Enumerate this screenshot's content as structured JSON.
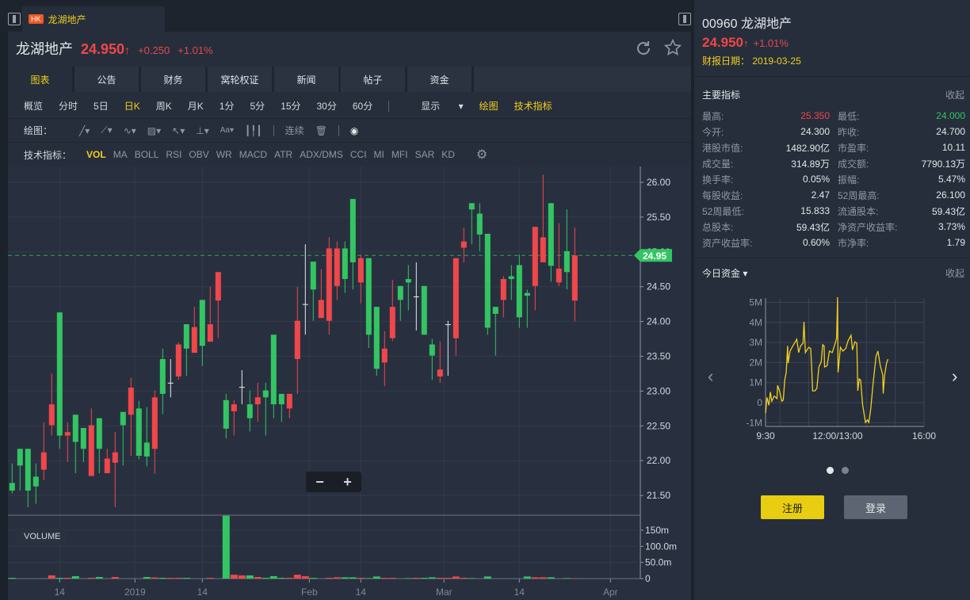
{
  "tab": {
    "market": "HK",
    "title": "龙湖地产"
  },
  "header": {
    "name": "龙湖地产",
    "price": "24.950",
    "arrow": "↑",
    "change": "+0.250",
    "change_pct": "+1.01%"
  },
  "tabs": [
    "图表",
    "公告",
    "财务",
    "窝轮权证",
    "新闻",
    "帖子",
    "资金"
  ],
  "periods": [
    "概览",
    "分时",
    "5日",
    "日K",
    "周K",
    "月K",
    "1分",
    "5分",
    "15分",
    "30分",
    "60分"
  ],
  "period_active": "日K",
  "toolbar": {
    "display": "显示",
    "draw": "绘图",
    "indicators": "技术指标"
  },
  "drawing": {
    "label": "绘图：",
    "continuous": "连续"
  },
  "indicators": {
    "label": "技术指标：",
    "items": [
      "VOL",
      "MA",
      "BOLL",
      "RSI",
      "OBV",
      "WR",
      "MACD",
      "ATR",
      "ADX/DMS",
      "CCI",
      "MI",
      "MFI",
      "SAR",
      "KD"
    ]
  },
  "zoom": {
    "minus": "−",
    "plus": "+"
  },
  "colors": {
    "up": "#f0474a",
    "down": "#33c562",
    "accent": "#f2cf1f",
    "bg": "#262e3b"
  },
  "side": {
    "title": "00960 龙湖地产",
    "price": "24.950",
    "arrow": "↑",
    "change_pct": "+1.01%",
    "report_label": "财报日期：",
    "report_date": "2019-03-25",
    "main_title": "主要指标",
    "collapse": "收起",
    "rows": [
      [
        "最高:",
        "25.350",
        "最低:",
        "24.000"
      ],
      [
        "今开:",
        "24.300",
        "昨收:",
        "24.700"
      ],
      [
        "港股市值:",
        "1482.90亿",
        "市盈率:",
        "10.11"
      ],
      [
        "成交量:",
        "314.89万",
        "成交额:",
        "7790.13万"
      ],
      [
        "换手率:",
        "0.05%",
        "振幅:",
        "5.47%"
      ],
      [
        "每股收益:",
        "2.47",
        "52周最高:",
        "26.100"
      ],
      [
        "52周最低:",
        "15.833",
        "流通股本:",
        "59.43亿"
      ],
      [
        "总股本:",
        "59.43亿",
        "净资产收益率:",
        "3.73%"
      ],
      [
        "资产收益率:",
        "0.60%",
        "市净率:",
        "1.79"
      ]
    ],
    "flow_title": "今日资金",
    "flow_collapse": "收起",
    "register": "注册",
    "login": "登录"
  },
  "chart_data": [
    {
      "type": "candlestick",
      "volume_label": "VOLUME",
      "last_price_label": "24.95",
      "last_price": 24.95,
      "ylim": [
        21.3,
        26.2
      ],
      "y_ticks": [
        "26.00",
        "25.50",
        "25.00",
        "24.50",
        "24.00",
        "23.50",
        "23.00",
        "22.50",
        "22.00",
        "21.50"
      ],
      "volume_ticks": [
        "150m",
        "100.0m",
        "50.0m",
        "0"
      ],
      "volume_tick_values": [
        150,
        100,
        50,
        0
      ],
      "volume_max": 196,
      "x_ticks": [
        {
          "label": "14",
          "index": 6
        },
        {
          "label": "2019",
          "index": 15.5
        },
        {
          "label": "14",
          "index": 24
        },
        {
          "label": "Feb",
          "index": 37.5
        },
        {
          "label": "14",
          "index": 44
        },
        {
          "label": "Mar",
          "index": 54.5
        },
        {
          "label": "14",
          "index": 64
        },
        {
          "label": "Apr",
          "index": 75.5
        }
      ],
      "ohlc": [
        [
          21.68,
          21.96,
          21.53,
          21.57
        ],
        [
          22.17,
          22.17,
          21.57,
          21.93
        ],
        [
          22.17,
          22.17,
          21.33,
          21.57
        ],
        [
          21.77,
          21.96,
          21.38,
          21.63
        ],
        [
          21.87,
          22.55,
          21.72,
          22.12
        ],
        [
          22.51,
          23.25,
          22.36,
          22.81
        ],
        [
          24.13,
          24.13,
          22.17,
          22.36
        ],
        [
          22.36,
          22.55,
          21.98,
          22.41
        ],
        [
          22.66,
          22.66,
          21.82,
          22.27
        ],
        [
          22.47,
          22.47,
          21.98,
          22.17
        ],
        [
          21.78,
          22.75,
          21.78,
          22.51
        ],
        [
          22.61,
          22.61,
          21.82,
          22.17
        ],
        [
          21.82,
          22.17,
          21.82,
          22.03
        ],
        [
          21.97,
          22.41,
          21.33,
          22.12
        ],
        [
          22.7,
          22.7,
          21.93,
          22.51
        ],
        [
          22.66,
          23.19,
          22.07,
          23.05
        ],
        [
          22.75,
          22.86,
          22.02,
          22.07
        ],
        [
          22.26,
          22.77,
          21.92,
          22.06
        ],
        [
          22.17,
          23.01,
          21.81,
          22.91
        ],
        [
          23.46,
          23.61,
          22.67,
          22.96
        ],
        [
          23.12,
          23.46,
          22.91,
          23.12
        ],
        [
          23.21,
          23.7,
          23.16,
          23.67
        ],
        [
          23.96,
          23.96,
          23.22,
          23.61
        ],
        [
          23.55,
          24.21,
          23.55,
          23.92
        ],
        [
          24.31,
          24.31,
          23.36,
          23.65
        ],
        [
          23.71,
          24.5,
          23.71,
          23.96
        ],
        [
          24.3,
          24.71,
          23.76,
          24.71
        ],
        [
          22.87,
          22.96,
          22.32,
          22.46
        ],
        [
          22.71,
          22.87,
          22.36,
          22.81
        ],
        [
          23.06,
          23.3,
          22.81,
          23.06
        ],
        [
          22.81,
          23.01,
          22.42,
          22.61
        ],
        [
          22.81,
          23.12,
          22.56,
          22.91
        ],
        [
          23.01,
          23.12,
          22.36,
          22.91
        ],
        [
          23.81,
          23.81,
          22.61,
          22.81
        ],
        [
          22.96,
          22.96,
          22.56,
          22.81
        ],
        [
          22.75,
          22.96,
          22.61,
          22.96
        ],
        [
          23.46,
          24.5,
          22.96,
          24.01
        ],
        [
          24.25,
          25.11,
          23.81,
          24.25
        ],
        [
          24.86,
          24.86,
          24.01,
          24.46
        ],
        [
          24.05,
          24.75,
          24.05,
          24.31
        ],
        [
          24.01,
          25.21,
          23.81,
          25.05
        ],
        [
          24.51,
          25.15,
          24.31,
          25.05
        ],
        [
          25.05,
          25.15,
          24.41,
          24.61
        ],
        [
          25.76,
          25.76,
          24.46,
          24.85
        ],
        [
          24.56,
          24.96,
          24.26,
          24.91
        ],
        [
          24.91,
          24.91,
          23.62,
          23.81
        ],
        [
          24.21,
          24.21,
          23.22,
          23.32
        ],
        [
          23.41,
          23.86,
          23.07,
          23.61
        ],
        [
          23.76,
          24.6,
          23.72,
          24.21
        ],
        [
          24.51,
          24.51,
          24.01,
          24.31
        ],
        [
          24.61,
          24.81,
          24.16,
          24.56
        ],
        [
          24.36,
          24.85,
          23.87,
          24.36
        ],
        [
          24.51,
          24.51,
          23.81,
          23.81
        ],
        [
          23.67,
          23.75,
          23.16,
          23.51
        ],
        [
          23.21,
          23.71,
          23.12,
          23.31
        ],
        [
          23.96,
          24.01,
          23.22,
          23.96
        ],
        [
          23.76,
          24.91,
          23.51,
          24.91
        ],
        [
          25.06,
          25.35,
          24.85,
          25.15
        ],
        [
          25.7,
          25.7,
          25.11,
          25.61
        ],
        [
          25.55,
          25.7,
          25.01,
          25.25
        ],
        [
          25.26,
          25.26,
          23.81,
          23.91
        ],
        [
          24.21,
          24.21,
          23.51,
          24.11
        ],
        [
          24.31,
          24.65,
          24.06,
          24.61
        ],
        [
          24.65,
          24.81,
          24.31,
          24.61
        ],
        [
          24.81,
          24.96,
          23.91,
          24.06
        ],
        [
          24.41,
          24.46,
          23.91,
          24.37
        ],
        [
          24.51,
          25.36,
          24.16,
          25.36
        ],
        [
          24.85,
          26.11,
          24.85,
          25.21
        ],
        [
          25.7,
          25.7,
          24.57,
          24.8
        ],
        [
          24.56,
          25.41,
          24.51,
          24.76
        ],
        [
          25.01,
          25.61,
          24.46,
          24.71
        ],
        [
          24.3,
          25.35,
          24.0,
          24.95
        ]
      ],
      "volume": [
        2.5,
        0,
        0,
        0,
        0,
        10,
        2.5,
        2.5,
        7.5,
        0,
        2.5,
        5,
        0,
        5,
        0,
        0,
        0,
        5,
        3.5,
        2.5,
        2.5,
        2.5,
        2.5,
        0,
        0,
        2.5,
        0,
        195,
        12,
        10,
        10,
        5,
        2.5,
        7.5,
        2.5,
        2.5,
        12,
        7.5,
        2.5,
        0,
        2.5,
        4,
        4,
        4,
        2.5,
        1.6,
        6.5,
        2.5,
        2.5,
        0,
        1.6,
        2.5,
        2.5,
        4,
        2.5,
        2.5,
        6.5,
        2.5,
        1.6,
        0,
        6.5,
        0,
        0,
        0,
        0,
        6.5,
        4,
        4,
        4,
        0,
        1.6,
        1
      ]
    },
    {
      "type": "line",
      "title": "今日资金",
      "y_ticks": [
        "5M",
        "4M",
        "3M",
        "2M",
        "1M",
        "0",
        "-1M"
      ],
      "y_tick_values": [
        5,
        4,
        3,
        2,
        1,
        0,
        -1
      ],
      "ylim": [
        -1.2,
        5.2
      ],
      "x_ticks": [
        "9:30",
        "12:00/13:00",
        "16:00"
      ],
      "x_tick_minutes": [
        0,
        150,
        330
      ],
      "x_range_minutes": [
        0,
        330
      ],
      "unit": "M",
      "points": [
        [
          0,
          -0.53
        ],
        [
          3,
          0.26
        ],
        [
          7,
          -0.13
        ],
        [
          10,
          0.53
        ],
        [
          13,
          0.07
        ],
        [
          18,
          0.33
        ],
        [
          24,
          0.2
        ],
        [
          25,
          0.86
        ],
        [
          29,
          0.59
        ],
        [
          34,
          0.07
        ],
        [
          37,
          0.13
        ],
        [
          40,
          1.12
        ],
        [
          43,
          1.51
        ],
        [
          46,
          2.83
        ],
        [
          47,
          1.97
        ],
        [
          51,
          2.57
        ],
        [
          57,
          2.83
        ],
        [
          65,
          3.16
        ],
        [
          69,
          2.5
        ],
        [
          73,
          2.83
        ],
        [
          78,
          2.96
        ],
        [
          80,
          4.03
        ],
        [
          83,
          2.5
        ],
        [
          90,
          2.76
        ],
        [
          94,
          2.7
        ],
        [
          96,
          1.78
        ],
        [
          98,
          0.59
        ],
        [
          103,
          0.59
        ],
        [
          107,
          0.72
        ],
        [
          111,
          1.78
        ],
        [
          116,
          2.04
        ],
        [
          119,
          2.89
        ],
        [
          122,
          2.83
        ],
        [
          123,
          1.78
        ],
        [
          128,
          1.84
        ],
        [
          133,
          2.57
        ],
        [
          139,
          2.5
        ],
        [
          145,
          2.96
        ],
        [
          148,
          3.22
        ],
        [
          150,
          5.26
        ],
        [
          151,
          1.51
        ],
        [
          156,
          2.76
        ],
        [
          161,
          2.57
        ],
        [
          167,
          2.7
        ],
        [
          172,
          3.09
        ],
        [
          178,
          3.36
        ],
        [
          181,
          2.63
        ],
        [
          186,
          3.03
        ],
        [
          190,
          2.96
        ],
        [
          192,
          0.59
        ],
        [
          195,
          1.18
        ],
        [
          198,
          1.12
        ],
        [
          202,
          -0.07
        ],
        [
          208,
          -0.99
        ],
        [
          212,
          -0.86
        ],
        [
          215,
          -0.99
        ],
        [
          219,
          -0.33
        ],
        [
          224,
          0.99
        ],
        [
          227,
          1.64
        ],
        [
          230,
          2.3
        ],
        [
          234,
          2.57
        ],
        [
          239,
          1.84
        ],
        [
          244,
          1.38
        ],
        [
          245,
          0.46
        ],
        [
          248,
          1.38
        ],
        [
          252,
          1.97
        ],
        [
          255,
          2.17
        ]
      ]
    }
  ]
}
